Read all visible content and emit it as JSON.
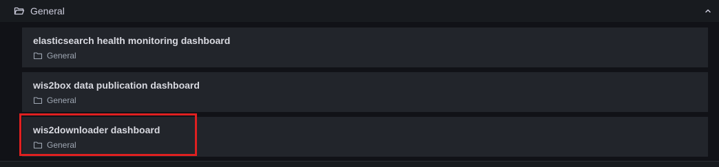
{
  "folder": {
    "title": "General",
    "icon": "folder-open-icon",
    "collapse_icon": "chevron-up-icon"
  },
  "dashboards": [
    {
      "title": "elasticsearch health monitoring dashboard",
      "folder": "General"
    },
    {
      "title": "wis2box data publication dashboard",
      "folder": "General"
    },
    {
      "title": "wis2downloader dashboard",
      "folder": "General"
    }
  ],
  "colors": {
    "background": "#111217",
    "card": "#22252b",
    "header": "#181b1f",
    "text_primary": "#d8d9e0",
    "text_secondary": "#9fa7b3",
    "highlight": "#e02020"
  }
}
